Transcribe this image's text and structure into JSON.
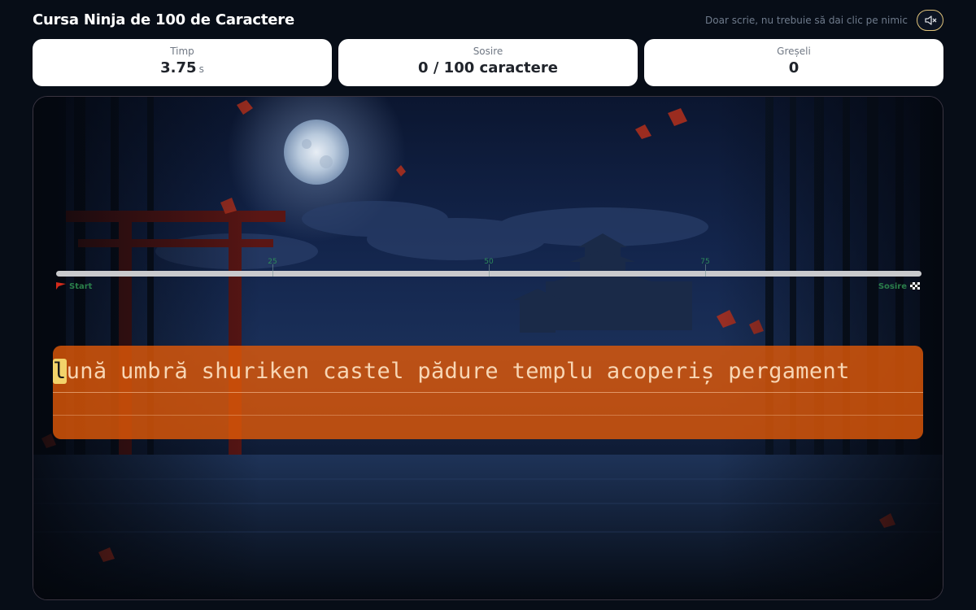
{
  "header": {
    "title": "Cursa Ninja de 100 de Caractere",
    "hint": "Doar scrie, nu trebuie să dai clic pe nimic",
    "sound_icon": "muted-speaker-icon"
  },
  "stats": {
    "time": {
      "label": "Timp",
      "value": "3.75",
      "unit": "s"
    },
    "finish": {
      "label": "Sosire",
      "value": "0 / 100 caractere"
    },
    "errors": {
      "label": "Greșeli",
      "value": "0"
    }
  },
  "track": {
    "ticks": [
      "25",
      "50",
      "75"
    ],
    "start_label": "Start",
    "finish_label": "Sosire",
    "progress": 0,
    "start_icon": "red-flag-icon",
    "finish_icon": "checkered-flag-icon"
  },
  "typing": {
    "current_char": "l",
    "remaining_text": "ună umbră shuriken castel pădure templu acoperiș pergament"
  },
  "colors": {
    "panel": "#e45a08",
    "cursor": "#f2d36a",
    "accent_border": "#e0c37a"
  }
}
